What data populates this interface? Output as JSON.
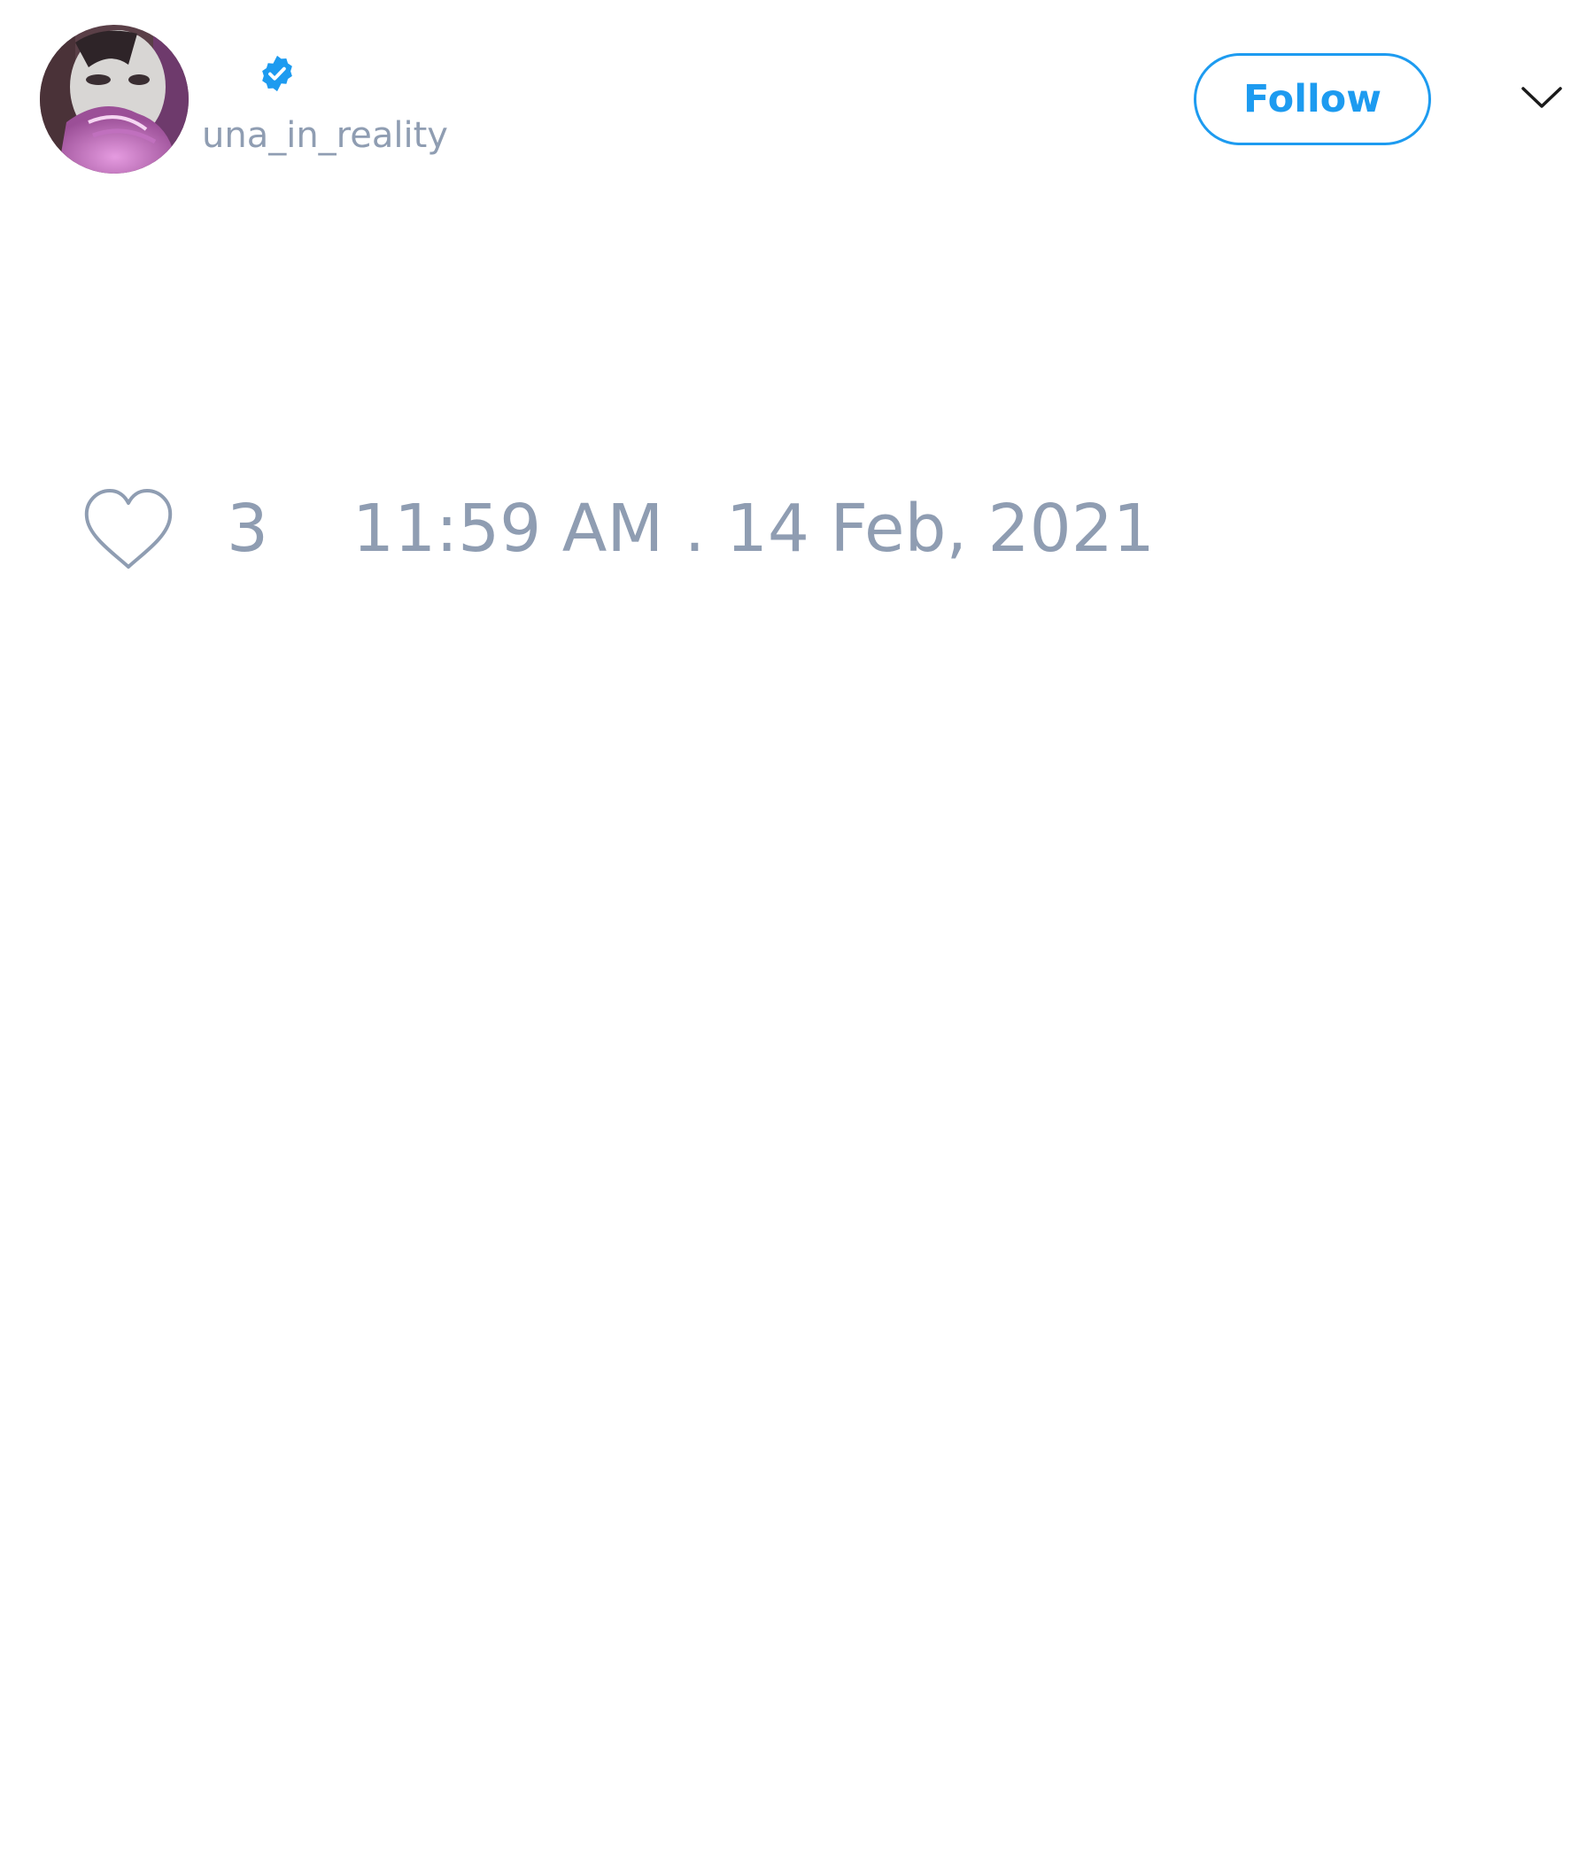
{
  "tweet": {
    "author": {
      "handle": "una_in_reality",
      "avatar_icon": "profile-avatar",
      "verified_icon": "verified-badge-icon"
    },
    "follow_label": "Follow",
    "menu_icon": "chevron-down-icon",
    "likes": {
      "icon": "heart-outline-icon",
      "count": "3"
    },
    "timestamp": "11:59 AM . 14 Feb, 2021"
  },
  "colors": {
    "accent": "#1d9bf0",
    "muted_text": "#8f9db2",
    "background": "#ffffff"
  }
}
